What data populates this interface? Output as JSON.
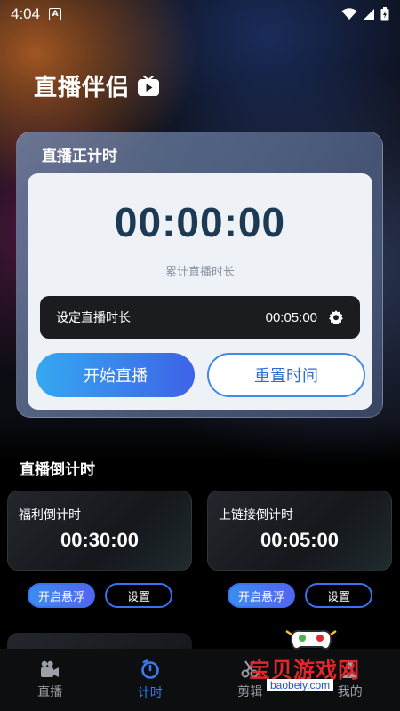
{
  "status_bar": {
    "time": "4:04",
    "notification_letter": "A"
  },
  "app": {
    "title": "直播伴侣"
  },
  "count_up": {
    "header": "直播正计时",
    "timer": "00:00:00",
    "caption": "累计直播时长",
    "setting_label": "设定直播时长",
    "setting_value": "00:05:00",
    "start_label": "开始直播",
    "reset_label": "重置时间"
  },
  "countdown": {
    "section_title": "直播倒计时",
    "cards": [
      {
        "label": "福利倒计时",
        "time": "00:30:00",
        "float_label": "开启悬浮",
        "settings_label": "设置"
      },
      {
        "label": "上链接倒计时",
        "time": "00:05:00",
        "float_label": "开启悬浮",
        "settings_label": "设置"
      }
    ]
  },
  "bottom_nav": {
    "items": [
      {
        "label": "直播",
        "icon": "video-camera-icon"
      },
      {
        "label": "计时",
        "icon": "timer-icon"
      },
      {
        "label": "剪辑",
        "icon": "scissors-icon"
      },
      {
        "label": "我的",
        "icon": "profile-icon"
      }
    ],
    "active_index": 1
  },
  "watermark": {
    "text": "宝贝游戏网",
    "url": "baobeiy.com"
  },
  "colors": {
    "accent": "#3a7cf0",
    "timer_text": "#1d3a55",
    "watermark_red": "#e3262a"
  }
}
